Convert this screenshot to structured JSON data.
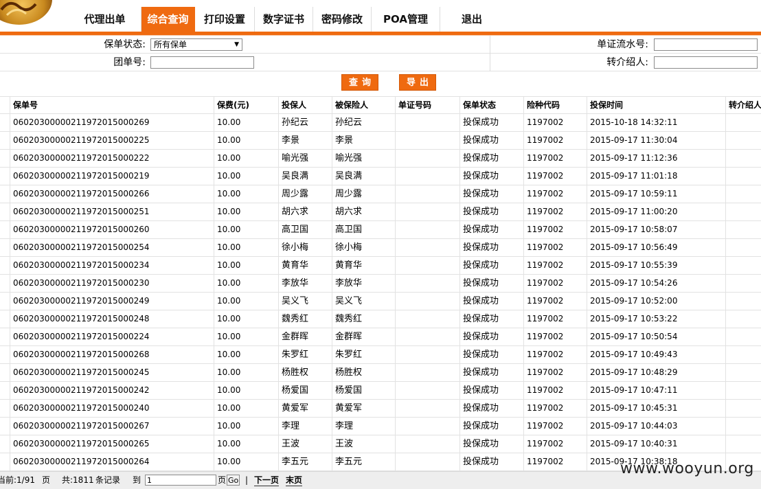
{
  "nav": [
    {
      "label": "代理出单",
      "active": false
    },
    {
      "label": "综合查询",
      "active": true
    },
    {
      "label": "打印设置",
      "active": false
    },
    {
      "label": "数字证书",
      "active": false
    },
    {
      "label": "密码修改",
      "active": false
    },
    {
      "label": "POA管理",
      "active": false
    },
    {
      "label": "退出",
      "active": false
    }
  ],
  "filters": {
    "status_label": "保单状态:",
    "status_value": "所有保单",
    "group_label": "团单号:",
    "group_value": "",
    "serial_label": "单证流水号:",
    "serial_value": "",
    "referrer_label": "转介绍人:",
    "referrer_value": ""
  },
  "buttons": {
    "query": "查询",
    "export": "导出"
  },
  "table": {
    "headers": [
      "保单号",
      "保费(元)",
      "投保人",
      "被保险人",
      "单证号码",
      "保单状态",
      "险种代码",
      "投保时间",
      "转介绍人"
    ],
    "rows": [
      [
        "06020300000211972015000269",
        "10.00",
        "孙纪云",
        "孙纪云",
        "",
        "投保成功",
        "1197002",
        "2015-10-18 14:32:11",
        ""
      ],
      [
        "06020300000211972015000225",
        "10.00",
        "李景",
        "李景",
        "",
        "投保成功",
        "1197002",
        "2015-09-17 11:30:04",
        ""
      ],
      [
        "06020300000211972015000222",
        "10.00",
        "喻光强",
        "喻光强",
        "",
        "投保成功",
        "1197002",
        "2015-09-17 11:12:36",
        ""
      ],
      [
        "06020300000211972015000219",
        "10.00",
        "吴良满",
        "吴良满",
        "",
        "投保成功",
        "1197002",
        "2015-09-17 11:01:18",
        ""
      ],
      [
        "06020300000211972015000266",
        "10.00",
        "周少露",
        "周少露",
        "",
        "投保成功",
        "1197002",
        "2015-09-17 10:59:11",
        ""
      ],
      [
        "06020300000211972015000251",
        "10.00",
        "胡六求",
        "胡六求",
        "",
        "投保成功",
        "1197002",
        "2015-09-17 11:00:20",
        ""
      ],
      [
        "06020300000211972015000260",
        "10.00",
        "高卫国",
        "高卫国",
        "",
        "投保成功",
        "1197002",
        "2015-09-17 10:58:07",
        ""
      ],
      [
        "06020300000211972015000254",
        "10.00",
        "徐小梅",
        "徐小梅",
        "",
        "投保成功",
        "1197002",
        "2015-09-17 10:56:49",
        ""
      ],
      [
        "06020300000211972015000234",
        "10.00",
        "黄育华",
        "黄育华",
        "",
        "投保成功",
        "1197002",
        "2015-09-17 10:55:39",
        ""
      ],
      [
        "06020300000211972015000230",
        "10.00",
        "李放华",
        "李放华",
        "",
        "投保成功",
        "1197002",
        "2015-09-17 10:54:26",
        ""
      ],
      [
        "06020300000211972015000249",
        "10.00",
        "吴义飞",
        "吴义飞",
        "",
        "投保成功",
        "1197002",
        "2015-09-17 10:52:00",
        ""
      ],
      [
        "06020300000211972015000248",
        "10.00",
        "魏秀红",
        "魏秀红",
        "",
        "投保成功",
        "1197002",
        "2015-09-17 10:53:22",
        ""
      ],
      [
        "06020300000211972015000224",
        "10.00",
        "金群晖",
        "金群晖",
        "",
        "投保成功",
        "1197002",
        "2015-09-17 10:50:54",
        ""
      ],
      [
        "06020300000211972015000268",
        "10.00",
        "朱罗红",
        "朱罗红",
        "",
        "投保成功",
        "1197002",
        "2015-09-17 10:49:43",
        ""
      ],
      [
        "06020300000211972015000245",
        "10.00",
        "杨胜权",
        "杨胜权",
        "",
        "投保成功",
        "1197002",
        "2015-09-17 10:48:29",
        ""
      ],
      [
        "06020300000211972015000242",
        "10.00",
        "杨爱国",
        "杨爱国",
        "",
        "投保成功",
        "1197002",
        "2015-09-17 10:47:11",
        ""
      ],
      [
        "06020300000211972015000240",
        "10.00",
        "黄爱军",
        "黄爱军",
        "",
        "投保成功",
        "1197002",
        "2015-09-17 10:45:31",
        ""
      ],
      [
        "06020300000211972015000267",
        "10.00",
        "李理",
        "李理",
        "",
        "投保成功",
        "1197002",
        "2015-09-17 10:44:03",
        ""
      ],
      [
        "06020300000211972015000265",
        "10.00",
        "王波",
        "王波",
        "",
        "投保成功",
        "1197002",
        "2015-09-17 10:40:31",
        ""
      ],
      [
        "06020300000211972015000264",
        "10.00",
        "李五元",
        "李五元",
        "",
        "投保成功",
        "1197002",
        "2015-09-17 10:38:18",
        ""
      ]
    ]
  },
  "pager": {
    "current": "当前:1/91",
    "page_unit": "页",
    "total": "共:1811",
    "record_unit": "条记录",
    "goto_label": "到",
    "goto_value": "1",
    "goto_unit": "页",
    "go": "Go",
    "separator": "|",
    "next": "下一页",
    "last": "末页"
  },
  "watermark": "www.wooyun.org",
  "colors": {
    "accent": "#ef6a10"
  }
}
